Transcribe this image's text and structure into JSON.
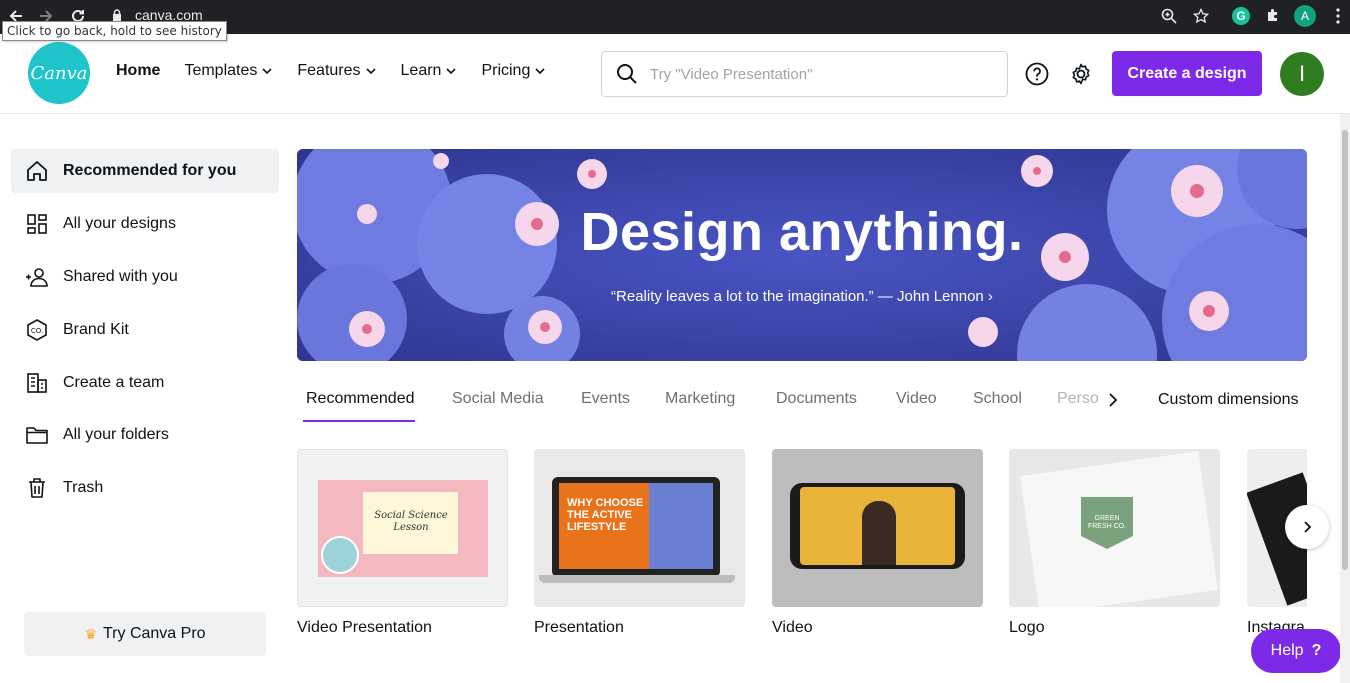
{
  "browser": {
    "url": "canva.com",
    "tooltip": "Click to go back, hold to see history",
    "profile_initial": "A",
    "extension_initial": "G"
  },
  "header": {
    "logo_text": "Canva",
    "nav": [
      {
        "label": "Home"
      },
      {
        "label": "Templates"
      },
      {
        "label": "Features"
      },
      {
        "label": "Learn"
      },
      {
        "label": "Pricing"
      }
    ],
    "search_placeholder": "Try \"Video Presentation\"",
    "create_label": "Create a design",
    "avatar_initial": "I"
  },
  "sidebar": {
    "items": [
      {
        "label": "Recommended for you",
        "icon": "home-icon"
      },
      {
        "label": "All your designs",
        "icon": "grid-icon"
      },
      {
        "label": "Shared with you",
        "icon": "people-icon"
      },
      {
        "label": "Brand Kit",
        "icon": "brand-kit-icon"
      },
      {
        "label": "Create a team",
        "icon": "building-icon"
      },
      {
        "label": "All your folders",
        "icon": "folder-icon"
      },
      {
        "label": "Trash",
        "icon": "trash-icon"
      }
    ],
    "pro_label": "Try Canva Pro"
  },
  "banner": {
    "title": "Design anything.",
    "quote": "“Reality leaves a lot to the imagination.” — John Lennon ›"
  },
  "tabs": {
    "items": [
      "Recommended",
      "Social Media",
      "Events",
      "Marketing",
      "Documents",
      "Video",
      "School",
      "Perso"
    ],
    "custom_label": "Custom dimensions"
  },
  "cards": [
    {
      "label": "Video Presentation",
      "thumb_text": "Social Science Lesson"
    },
    {
      "label": "Presentation",
      "thumb_text": "WHY CHOOSE THE ACTIVE LIFESTYLE"
    },
    {
      "label": "Video"
    },
    {
      "label": "Logo",
      "thumb_text": "GREEN FRESH CO."
    },
    {
      "label": "Instagra"
    }
  ],
  "help": {
    "label": "Help",
    "mark": "?"
  },
  "colors": {
    "brand_purple": "#7d2ae8",
    "logo_teal": "#20c4cb",
    "banner_blue": "#3a44a8"
  }
}
